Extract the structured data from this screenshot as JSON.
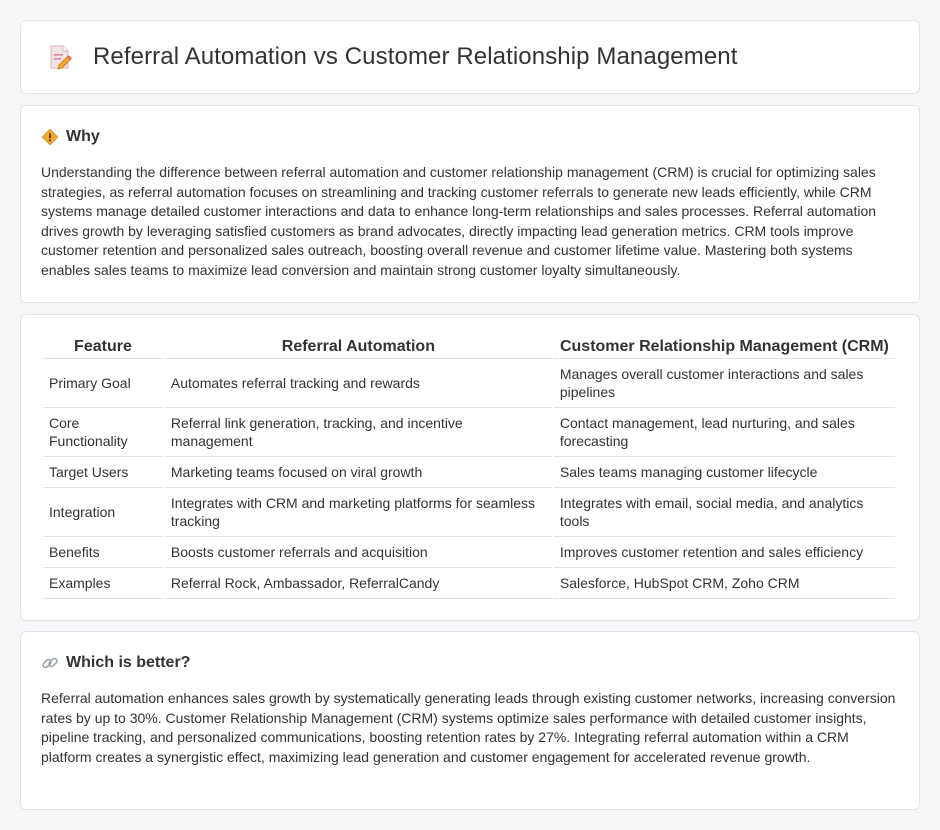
{
  "header": {
    "title": "Referral Automation vs Customer Relationship Management",
    "icon": "document-pencil-icon"
  },
  "why": {
    "title": "Why",
    "icon": "diamond-sign-icon",
    "text": "Understanding the difference between referral automation and customer relationship management (CRM) is crucial for optimizing sales strategies, as referral automation focuses on streamlining and tracking customer referrals to generate new leads efficiently, while CRM systems manage detailed customer interactions and data to enhance long-term relationships and sales processes. Referral automation drives growth by leveraging satisfied customers as brand advocates, directly impacting lead generation metrics. CRM tools improve customer retention and personalized sales outreach, boosting overall revenue and customer lifetime value. Mastering both systems enables sales teams to maximize lead conversion and maintain strong customer loyalty simultaneously."
  },
  "table": {
    "headers": [
      "Feature",
      "Referral Automation",
      "Customer Relationship Management (CRM)"
    ],
    "rows": [
      [
        "Primary Goal",
        "Automates referral tracking and rewards",
        "Manages overall customer interactions and sales pipelines"
      ],
      [
        "Core Functionality",
        "Referral link generation, tracking, and incentive management",
        "Contact management, lead nurturing, and sales forecasting"
      ],
      [
        "Target Users",
        "Marketing teams focused on viral growth",
        "Sales teams managing customer lifecycle"
      ],
      [
        "Integration",
        "Integrates with CRM and marketing platforms for seamless tracking",
        "Integrates with email, social media, and analytics tools"
      ],
      [
        "Benefits",
        "Boosts customer referrals and acquisition",
        "Improves customer retention and sales efficiency"
      ],
      [
        "Examples",
        "Referral Rock, Ambassador, ReferralCandy",
        "Salesforce, HubSpot CRM, Zoho CRM"
      ]
    ]
  },
  "better": {
    "title": "Which is better?",
    "icon": "link-icon",
    "text": "Referral automation enhances sales growth by systematically generating leads through existing customer networks, increasing conversion rates by up to 30%. Customer Relationship Management (CRM) systems optimize sales performance with detailed customer insights, pipeline tracking, and personalized communications, boosting retention rates by 27%. Integrating referral automation within a CRM platform creates a synergistic effect, maximizing lead generation and customer engagement for accelerated revenue growth."
  },
  "colors": {
    "background": "#f5f6f8",
    "card": "#ffffff",
    "border": "#e2e4e8",
    "text": "#333333",
    "icon_accent": "#f0a830"
  }
}
